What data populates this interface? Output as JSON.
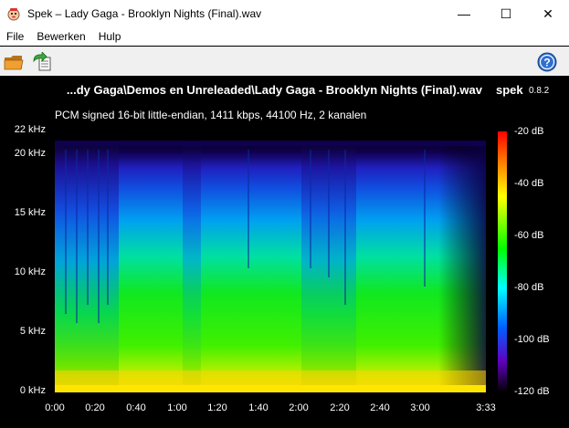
{
  "window": {
    "title": "Spek – Lady Gaga - Brooklyn Nights (Final).wav",
    "minimize_glyph": "—",
    "maximize_glyph": "☐",
    "close_glyph": "✕"
  },
  "menu": [
    "File",
    "Bewerken",
    "Hulp"
  ],
  "toolbar": {
    "open_icon": "open-folder-icon",
    "save_icon": "save-icon",
    "help_icon": "help-icon"
  },
  "spectrogram": {
    "file_title": "...dy Gaga\\Demos en Unreleaded\\Lady Gaga - Brooklyn Nights (Final).wav",
    "app_name": "spek",
    "app_version": "0.8.2",
    "description": "PCM signed 16-bit little-endian, 1411 kbps, 44100 Hz, 2 kanalen",
    "y_labels": [
      "22 kHz",
      "20 kHz",
      "15 kHz",
      "10 kHz",
      "5 kHz",
      "0 kHz"
    ],
    "x_labels": [
      "0:00",
      "0:20",
      "0:40",
      "1:00",
      "1:20",
      "1:40",
      "2:00",
      "2:20",
      "2:40",
      "3:00",
      "3:33"
    ],
    "db_labels": [
      "-20 dB",
      "-40 dB",
      "-60 dB",
      "-80 dB",
      "-100 dB",
      "-120 dB"
    ],
    "colors": {
      "background": "#000000",
      "text": "#ffffff"
    }
  }
}
